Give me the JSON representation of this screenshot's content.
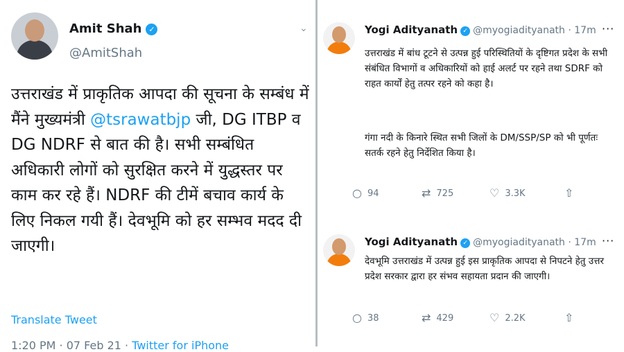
{
  "left_tweet": {
    "author": "Amit Shah",
    "handle": "@AmitShah",
    "verified_glyph": "✓",
    "menu_glyph": "⌄",
    "text_before": "उत्तराखंड में प्राकृतिक आपदा की सूचना के सम्बंध में मैंने मुख्यमंत्री ",
    "mention": "@tsrawatbjp",
    "text_after": " जी, DG ITBP व DG NDRF से बात की है। सभी सम्बंधित अधिकारी लोगों को सुरक्षित करने में युद्धस्तर पर काम कर रहे हैं। NDRF की टीमें बचाव कार्य के लिए निकल गयी हैं। देवभूमि को हर सम्भव मदद दी जाएगी।",
    "translate": "Translate Tweet",
    "time_date": "1:20 PM · 07 Feb 21 · ",
    "source": "Twitter for iPhone"
  },
  "right_tweets": [
    {
      "author": "Yogi Adityanath",
      "handle": "@myogiadityanath · 17m",
      "para1": "उत्तराखंड में बांध टूटने से उत्पन्न हुई परिस्थितियों के दृष्टिगत प्रदेश के सभी संबंधित विभागों व अधिकारियों को हाई अलर्ट पर रहने तथा SDRF को राहत कार्यों हेतु तत्पर रहने को कहा है।",
      "para2": "गंगा नदी के किनारे स्थित सभी जिलों के DM/SSP/SP को भी पूर्णतः सतर्क रहने हेतु निर्देशित किया है।",
      "replies": "94",
      "retweets": "725",
      "likes": "3.3K"
    },
    {
      "author": "Yogi Adityanath",
      "handle": "@myogiadityanath · 17m",
      "para1": "देवभूमि उत्तराखंड में उत्पन्न हुई इस प्राकृतिक आपदा से निपटने हेतु उत्तर प्रदेश सरकार द्वारा हर संभव सहायता प्रदान की जाएगी।",
      "replies": "38",
      "retweets": "429",
      "likes": "2.2K"
    }
  ],
  "icons": {
    "reply": "○",
    "retweet": "⇄",
    "like": "♡",
    "share": "⇧",
    "more": "···"
  },
  "colors": {
    "twitter_blue": "#1da1f2",
    "text": "#14171a",
    "muted": "#657786"
  }
}
